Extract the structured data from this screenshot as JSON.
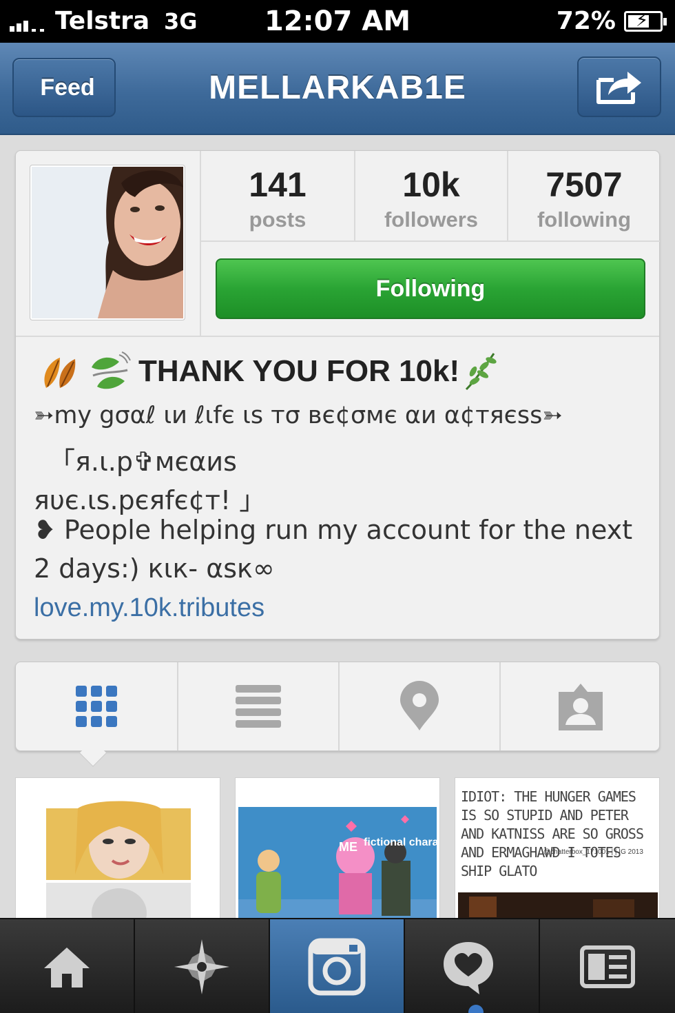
{
  "status_bar": {
    "carrier": "Telstra",
    "network": "3G",
    "time": "12:07 AM",
    "battery": "72%"
  },
  "nav": {
    "back_label": "Feed",
    "title": "MELLARKAB1E",
    "share_icon": "share-icon"
  },
  "profile": {
    "stats": [
      {
        "value": "141",
        "label": "posts"
      },
      {
        "value": "10k",
        "label": "followers"
      },
      {
        "value": "7507",
        "label": "following"
      }
    ],
    "follow_button": "Following",
    "bio": {
      "title": "THANK YOU FOR 10k!",
      "line1": "➳my gσαℓ ιи ℓιfє ιѕ тσ вє¢σмє αи α¢тяєѕѕ➳",
      "line2": "「я.ι.p✞мєαиѕ",
      "line3": "яυє.ιѕ.pєяfє¢т! 」",
      "line4": "❥ People helping run my account for the next",
      "line5": "2 days:) кιк- αѕк∞",
      "link": "love.my.10k.tributes"
    }
  },
  "view_tabs": [
    "grid-icon",
    "list-icon",
    "location-icon",
    "tagged-icon"
  ],
  "photos": [
    {
      "icon": "photo-portrait"
    },
    {
      "icon": "photo-cartoon",
      "label_me": "ME",
      "label_char": "fictional character"
    },
    {
      "icon": "photo-quote",
      "text": "IDIOT: THE HUNGER GAMES IS SO STUPID AND PETER AND KATNISS ARE SO GROSS AND ERMAGHAWD I TOTES SHIP GLATO",
      "credit": "@chatterbox_171001 | | IG 2013"
    }
  ],
  "tab_bar": [
    "home-icon",
    "explore-icon",
    "camera-icon",
    "activity-icon",
    "profile-icon"
  ],
  "colors": {
    "nav_blue": "#3e6a9a",
    "follow_green": "#2aa434",
    "link_blue": "#3b6fa5",
    "active_tab": "#3b77c0"
  }
}
